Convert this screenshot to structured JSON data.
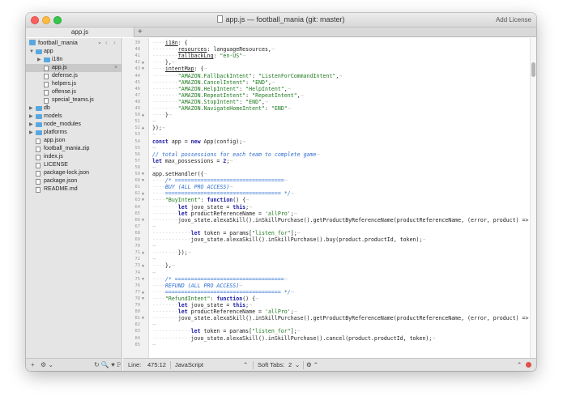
{
  "window": {
    "title": "app.js — football_mania (git: master)",
    "license_label": "Add License"
  },
  "tabs": {
    "active_tab": "app.js",
    "add_label": "+"
  },
  "sidebar": {
    "project_name": "football_mania",
    "project_chevron": "⌄",
    "nav_back": "‹",
    "nav_forward": "›",
    "tree": [
      {
        "label": "app",
        "kind": "folder",
        "depth": 0,
        "expanded": true
      },
      {
        "label": "i18n",
        "kind": "folder",
        "depth": 1,
        "expanded": false
      },
      {
        "label": "app.js",
        "kind": "file",
        "depth": 1,
        "selected": true
      },
      {
        "label": "defense.js",
        "kind": "file",
        "depth": 1
      },
      {
        "label": "helpers.js",
        "kind": "file",
        "depth": 1
      },
      {
        "label": "offense.js",
        "kind": "file",
        "depth": 1
      },
      {
        "label": "special_teams.js",
        "kind": "file",
        "depth": 1
      },
      {
        "label": "db",
        "kind": "folder",
        "depth": 0,
        "expanded": false
      },
      {
        "label": "models",
        "kind": "folder",
        "depth": 0,
        "expanded": false
      },
      {
        "label": "node_modules",
        "kind": "folder",
        "depth": 0,
        "expanded": false
      },
      {
        "label": "platforms",
        "kind": "folder",
        "depth": 0,
        "expanded": false
      },
      {
        "label": "app.json",
        "kind": "file",
        "depth": 0
      },
      {
        "label": "football_mania.zip",
        "kind": "file",
        "depth": 0
      },
      {
        "label": "index.js",
        "kind": "file",
        "depth": 0
      },
      {
        "label": "LICENSE",
        "kind": "file",
        "depth": 0
      },
      {
        "label": "package-lock.json",
        "kind": "file",
        "depth": 0
      },
      {
        "label": "package.json",
        "kind": "file",
        "depth": 0
      },
      {
        "label": "README.md",
        "kind": "file",
        "depth": 0
      }
    ],
    "footer": {
      "add": "+",
      "gear": "⚙ ⌄",
      "tools": "↻ 🔍 ♥ 𝙿"
    }
  },
  "editor": {
    "lines": [
      {
        "n": "39",
        "fold": "",
        "tokens": [
          {
            "t": "····",
            "c": "ws"
          },
          {
            "t": "i18n",
            "c": "prop"
          },
          {
            "t": ": {",
            "c": "plain"
          }
        ]
      },
      {
        "n": "40",
        "fold": "",
        "tokens": [
          {
            "t": "········",
            "c": "ws"
          },
          {
            "t": "resources",
            "c": "prop"
          },
          {
            "t": ": languageResources,",
            "c": "plain"
          },
          {
            "t": "¬",
            "c": "ws"
          }
        ]
      },
      {
        "n": "41",
        "fold": "",
        "tokens": [
          {
            "t": "········",
            "c": "ws"
          },
          {
            "t": "fallbackLng",
            "c": "prop"
          },
          {
            "t": ": ",
            "c": "plain"
          },
          {
            "t": "\"en-US\"",
            "c": "str"
          },
          {
            "t": "¬",
            "c": "ws"
          }
        ]
      },
      {
        "n": "42",
        "fold": "▲",
        "tokens": [
          {
            "t": "····",
            "c": "ws"
          },
          {
            "t": "},",
            "c": "plain"
          },
          {
            "t": "¬",
            "c": "ws"
          }
        ]
      },
      {
        "n": "43",
        "fold": "▼",
        "tokens": [
          {
            "t": "····",
            "c": "ws"
          },
          {
            "t": "intentMap",
            "c": "prop"
          },
          {
            "t": ": {",
            "c": "plain"
          },
          {
            "t": "¬",
            "c": "ws"
          }
        ]
      },
      {
        "n": "44",
        "fold": "",
        "tokens": [
          {
            "t": "········",
            "c": "ws"
          },
          {
            "t": "\"AMAZON.FallbackIntent\"",
            "c": "str"
          },
          {
            "t": ": ",
            "c": "plain"
          },
          {
            "t": "\"ListenForCommandIntent\"",
            "c": "str"
          },
          {
            "t": ",",
            "c": "plain"
          },
          {
            "t": "¬",
            "c": "ws"
          }
        ]
      },
      {
        "n": "45",
        "fold": "",
        "tokens": [
          {
            "t": "········",
            "c": "ws"
          },
          {
            "t": "\"AMAZON.CancelIntent\"",
            "c": "str"
          },
          {
            "t": ": ",
            "c": "plain"
          },
          {
            "t": "\"END\"",
            "c": "str"
          },
          {
            "t": ",",
            "c": "plain"
          },
          {
            "t": "¬",
            "c": "ws"
          }
        ]
      },
      {
        "n": "46",
        "fold": "",
        "tokens": [
          {
            "t": "········",
            "c": "ws"
          },
          {
            "t": "\"AMAZON.HelpIntent\"",
            "c": "str"
          },
          {
            "t": ": ",
            "c": "plain"
          },
          {
            "t": "\"HelpIntent\"",
            "c": "str"
          },
          {
            "t": ",",
            "c": "plain"
          },
          {
            "t": "¬",
            "c": "ws"
          }
        ]
      },
      {
        "n": "47",
        "fold": "",
        "tokens": [
          {
            "t": "········",
            "c": "ws"
          },
          {
            "t": "\"AMAZON.RepeatIntent\"",
            "c": "str"
          },
          {
            "t": ": ",
            "c": "plain"
          },
          {
            "t": "\"RepeatIntent\"",
            "c": "str"
          },
          {
            "t": ",",
            "c": "plain"
          },
          {
            "t": "¬",
            "c": "ws"
          }
        ]
      },
      {
        "n": "48",
        "fold": "",
        "tokens": [
          {
            "t": "········",
            "c": "ws"
          },
          {
            "t": "\"AMAZON.StopIntent\"",
            "c": "str"
          },
          {
            "t": ": ",
            "c": "plain"
          },
          {
            "t": "\"END\"",
            "c": "str"
          },
          {
            "t": ",",
            "c": "plain"
          },
          {
            "t": "¬",
            "c": "ws"
          }
        ]
      },
      {
        "n": "49",
        "fold": "",
        "tokens": [
          {
            "t": "········",
            "c": "ws"
          },
          {
            "t": "\"AMAZON.NavigateHomeIntent\"",
            "c": "str"
          },
          {
            "t": ": ",
            "c": "plain"
          },
          {
            "t": "\"END\"",
            "c": "str"
          },
          {
            "t": "¬",
            "c": "ws"
          }
        ]
      },
      {
        "n": "50",
        "fold": "▲",
        "tokens": [
          {
            "t": "····",
            "c": "ws"
          },
          {
            "t": "}",
            "c": "plain"
          },
          {
            "t": "¬",
            "c": "ws"
          }
        ]
      },
      {
        "n": "51",
        "fold": "",
        "tokens": [
          {
            "t": "¬",
            "c": "ws"
          }
        ]
      },
      {
        "n": "52",
        "fold": "▲",
        "tokens": [
          {
            "t": "});",
            "c": "plain"
          },
          {
            "t": "¬",
            "c": "ws"
          }
        ]
      },
      {
        "n": "53",
        "fold": "",
        "tokens": [
          {
            "t": "¬",
            "c": "ws"
          }
        ]
      },
      {
        "n": "54",
        "fold": "",
        "tokens": [
          {
            "t": "const ",
            "c": "kw"
          },
          {
            "t": "app = ",
            "c": "plain"
          },
          {
            "t": "new ",
            "c": "kw"
          },
          {
            "t": "App(config);",
            "c": "plain"
          },
          {
            "t": "¬",
            "c": "ws"
          }
        ]
      },
      {
        "n": "55",
        "fold": "",
        "tokens": [
          {
            "t": "¬",
            "c": "ws"
          }
        ]
      },
      {
        "n": "56",
        "fold": "",
        "tokens": [
          {
            "t": "// total possessions for each team to complete game",
            "c": "cm"
          },
          {
            "t": "¬",
            "c": "ws"
          }
        ]
      },
      {
        "n": "57",
        "fold": "",
        "tokens": [
          {
            "t": "let ",
            "c": "kw"
          },
          {
            "t": "max_possessions = ",
            "c": "plain"
          },
          {
            "t": "2",
            "c": "kw"
          },
          {
            "t": ";",
            "c": "plain"
          },
          {
            "t": "¬",
            "c": "ws"
          }
        ]
      },
      {
        "n": "58",
        "fold": "",
        "tokens": [
          {
            "t": "¬",
            "c": "ws"
          }
        ]
      },
      {
        "n": "59",
        "fold": "▼",
        "tokens": [
          {
            "t": "app.setHandler({",
            "c": "plain"
          },
          {
            "t": "¬",
            "c": "ws"
          }
        ]
      },
      {
        "n": "60",
        "fold": "▼",
        "tokens": [
          {
            "t": "····",
            "c": "ws"
          },
          {
            "t": "/* ==================================",
            "c": "cm"
          },
          {
            "t": "¬",
            "c": "ws"
          }
        ]
      },
      {
        "n": "61",
        "fold": "",
        "tokens": [
          {
            "t": "····",
            "c": "ws"
          },
          {
            "t": "BUY (ALL PRO ACCESS)",
            "c": "cm"
          },
          {
            "t": "¬",
            "c": "ws"
          }
        ]
      },
      {
        "n": "62",
        "fold": "▲",
        "tokens": [
          {
            "t": "····",
            "c": "ws"
          },
          {
            "t": "==================================== */",
            "c": "cm"
          },
          {
            "t": "¬",
            "c": "ws"
          }
        ]
      },
      {
        "n": "63",
        "fold": "▼",
        "tokens": [
          {
            "t": "····",
            "c": "ws"
          },
          {
            "t": "\"BuyIntent\"",
            "c": "str"
          },
          {
            "t": ": ",
            "c": "plain"
          },
          {
            "t": "function",
            "c": "kw"
          },
          {
            "t": "() {",
            "c": "plain"
          },
          {
            "t": "¬",
            "c": "ws"
          }
        ]
      },
      {
        "n": "64",
        "fold": "",
        "tokens": [
          {
            "t": "········",
            "c": "ws"
          },
          {
            "t": "let ",
            "c": "kw"
          },
          {
            "t": "jovo_state = ",
            "c": "plain"
          },
          {
            "t": "this",
            "c": "kw"
          },
          {
            "t": ";",
            "c": "plain"
          },
          {
            "t": "¬",
            "c": "ws"
          }
        ]
      },
      {
        "n": "65",
        "fold": "",
        "tokens": [
          {
            "t": "········",
            "c": "ws"
          },
          {
            "t": "let ",
            "c": "kw"
          },
          {
            "t": "productReferenceName = ",
            "c": "plain"
          },
          {
            "t": "'allPro'",
            "c": "str"
          },
          {
            "t": ";",
            "c": "plain"
          },
          {
            "t": "¬",
            "c": "ws"
          }
        ]
      },
      {
        "n": "66",
        "fold": "▼",
        "tokens": [
          {
            "t": "········",
            "c": "ws"
          },
          {
            "t": "jovo_state.alexaSkill().inSkillPurchase().getProductByReferenceName(productReferenceName, (error, product) => {",
            "c": "plain"
          },
          {
            "t": "¬",
            "c": "ws"
          }
        ]
      },
      {
        "n": "67",
        "fold": "",
        "tokens": [
          {
            "t": "¬",
            "c": "ws"
          }
        ]
      },
      {
        "n": "68",
        "fold": "",
        "tokens": [
          {
            "t": "············",
            "c": "ws"
          },
          {
            "t": "let ",
            "c": "kw"
          },
          {
            "t": "token = params[",
            "c": "plain"
          },
          {
            "t": "\"listen_for\"",
            "c": "str"
          },
          {
            "t": "];",
            "c": "plain"
          },
          {
            "t": "¬",
            "c": "ws"
          }
        ]
      },
      {
        "n": "69",
        "fold": "",
        "tokens": [
          {
            "t": "············",
            "c": "ws"
          },
          {
            "t": "jovo_state.alexaSkill().inSkillPurchase().buy(product.productId, token);",
            "c": "plain"
          },
          {
            "t": "¬",
            "c": "ws"
          }
        ]
      },
      {
        "n": "70",
        "fold": "",
        "tokens": [
          {
            "t": "¬",
            "c": "ws"
          }
        ]
      },
      {
        "n": "71",
        "fold": "▲",
        "tokens": [
          {
            "t": "········",
            "c": "ws"
          },
          {
            "t": "});",
            "c": "plain"
          },
          {
            "t": "¬",
            "c": "ws"
          }
        ]
      },
      {
        "n": "72",
        "fold": "",
        "tokens": [
          {
            "t": "¬",
            "c": "ws"
          }
        ]
      },
      {
        "n": "73",
        "fold": "▲",
        "tokens": [
          {
            "t": "····",
            "c": "ws"
          },
          {
            "t": "},",
            "c": "plain"
          },
          {
            "t": "¬",
            "c": "ws"
          }
        ]
      },
      {
        "n": "74",
        "fold": "",
        "tokens": [
          {
            "t": "¬",
            "c": "ws"
          }
        ]
      },
      {
        "n": "75",
        "fold": "▼",
        "tokens": [
          {
            "t": "····",
            "c": "ws"
          },
          {
            "t": "/* ==================================",
            "c": "cm"
          },
          {
            "t": "¬",
            "c": "ws"
          }
        ]
      },
      {
        "n": "76",
        "fold": "",
        "tokens": [
          {
            "t": "····",
            "c": "ws"
          },
          {
            "t": "REFUND (ALL PRO ACCESS)",
            "c": "cm"
          },
          {
            "t": "¬",
            "c": "ws"
          }
        ]
      },
      {
        "n": "77",
        "fold": "▲",
        "tokens": [
          {
            "t": "····",
            "c": "ws"
          },
          {
            "t": "==================================== */",
            "c": "cm"
          },
          {
            "t": "¬",
            "c": "ws"
          }
        ]
      },
      {
        "n": "78",
        "fold": "▼",
        "tokens": [
          {
            "t": "····",
            "c": "ws"
          },
          {
            "t": "\"RefundIntent\"",
            "c": "str"
          },
          {
            "t": ": ",
            "c": "plain"
          },
          {
            "t": "function",
            "c": "kw"
          },
          {
            "t": "() {",
            "c": "plain"
          },
          {
            "t": "¬",
            "c": "ws"
          }
        ]
      },
      {
        "n": "79",
        "fold": "",
        "tokens": [
          {
            "t": "········",
            "c": "ws"
          },
          {
            "t": "let ",
            "c": "kw"
          },
          {
            "t": "jovo_state = ",
            "c": "plain"
          },
          {
            "t": "this",
            "c": "kw"
          },
          {
            "t": ";",
            "c": "plain"
          },
          {
            "t": "¬",
            "c": "ws"
          }
        ]
      },
      {
        "n": "80",
        "fold": "",
        "tokens": [
          {
            "t": "········",
            "c": "ws"
          },
          {
            "t": "let ",
            "c": "kw"
          },
          {
            "t": "productReferenceName = ",
            "c": "plain"
          },
          {
            "t": "'allPro'",
            "c": "str"
          },
          {
            "t": ";",
            "c": "plain"
          },
          {
            "t": "¬",
            "c": "ws"
          }
        ]
      },
      {
        "n": "81",
        "fold": "▼",
        "tokens": [
          {
            "t": "········",
            "c": "ws"
          },
          {
            "t": "jovo_state.alexaSkill().inSkillPurchase().getProductByReferenceName(productReferenceName, (error, product) => {",
            "c": "plain"
          },
          {
            "t": "¬",
            "c": "ws"
          }
        ]
      },
      {
        "n": "82",
        "fold": "",
        "tokens": [
          {
            "t": "¬",
            "c": "ws"
          }
        ]
      },
      {
        "n": "83",
        "fold": "",
        "tokens": [
          {
            "t": "············",
            "c": "ws"
          },
          {
            "t": "let ",
            "c": "kw"
          },
          {
            "t": "token = params[",
            "c": "plain"
          },
          {
            "t": "\"listen_for\"",
            "c": "str"
          },
          {
            "t": "];",
            "c": "plain"
          },
          {
            "t": "¬",
            "c": "ws"
          }
        ]
      },
      {
        "n": "84",
        "fold": "",
        "tokens": [
          {
            "t": "············",
            "c": "ws"
          },
          {
            "t": "jovo_state.alexaSkill().inSkillPurchase().cancel(product.productId, token);",
            "c": "plain"
          },
          {
            "t": "¬",
            "c": "ws"
          }
        ]
      },
      {
        "n": "85",
        "fold": "",
        "tokens": [
          {
            "t": "¬",
            "c": "ws"
          }
        ]
      }
    ]
  },
  "statusbar": {
    "line_label": "Line:",
    "position": "475:12",
    "language": "JavaScript",
    "language_chevron": "⌃",
    "soft_tabs": "Soft Tabs:",
    "tab_size": "2",
    "tab_chevron": "⌄",
    "gear": "⚙ ⌃",
    "right_chevron": "⌃"
  },
  "colors": {
    "accent": "#5aa7e0",
    "string": "#1f7a1f",
    "keyword": "#1a1aa6",
    "comment": "#2f6fd0",
    "status_dot": "#e0504a"
  }
}
